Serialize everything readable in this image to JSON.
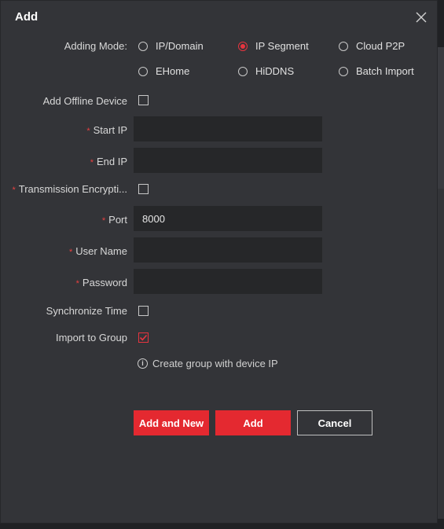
{
  "dialog": {
    "title": "Add"
  },
  "adding_mode": {
    "label": "Adding Mode:",
    "options": [
      {
        "label": "IP/Domain",
        "checked": false
      },
      {
        "label": "IP Segment",
        "checked": true
      },
      {
        "label": "Cloud P2P",
        "checked": false
      },
      {
        "label": "EHome",
        "checked": false
      },
      {
        "label": "HiDDNS",
        "checked": false
      },
      {
        "label": "Batch Import",
        "checked": false
      }
    ]
  },
  "form": {
    "add_offline_device": {
      "label": "Add Offline Device",
      "checked": false
    },
    "start_ip": {
      "label": "Start IP",
      "value": ""
    },
    "end_ip": {
      "label": "End IP",
      "value": ""
    },
    "transmission_encryption": {
      "label": "Transmission Encrypti...",
      "checked": false
    },
    "port": {
      "label": "Port",
      "value": "8000"
    },
    "user_name": {
      "label": "User Name",
      "value": ""
    },
    "password": {
      "label": "Password",
      "value": ""
    },
    "synchronize_time": {
      "label": "Synchronize Time",
      "checked": false
    },
    "import_to_group": {
      "label": "Import to Group",
      "checked": true
    },
    "group_hint": "Create group with device IP",
    "required_mark": "*"
  },
  "buttons": {
    "add_and_new": "Add and New",
    "add": "Add",
    "cancel": "Cancel"
  },
  "colors": {
    "accent": "#e42930",
    "dialog_bg": "#333438",
    "input_bg": "#262729"
  },
  "icons": {
    "close": "close-icon",
    "info": "info-icon",
    "check": "checkmark-icon"
  }
}
